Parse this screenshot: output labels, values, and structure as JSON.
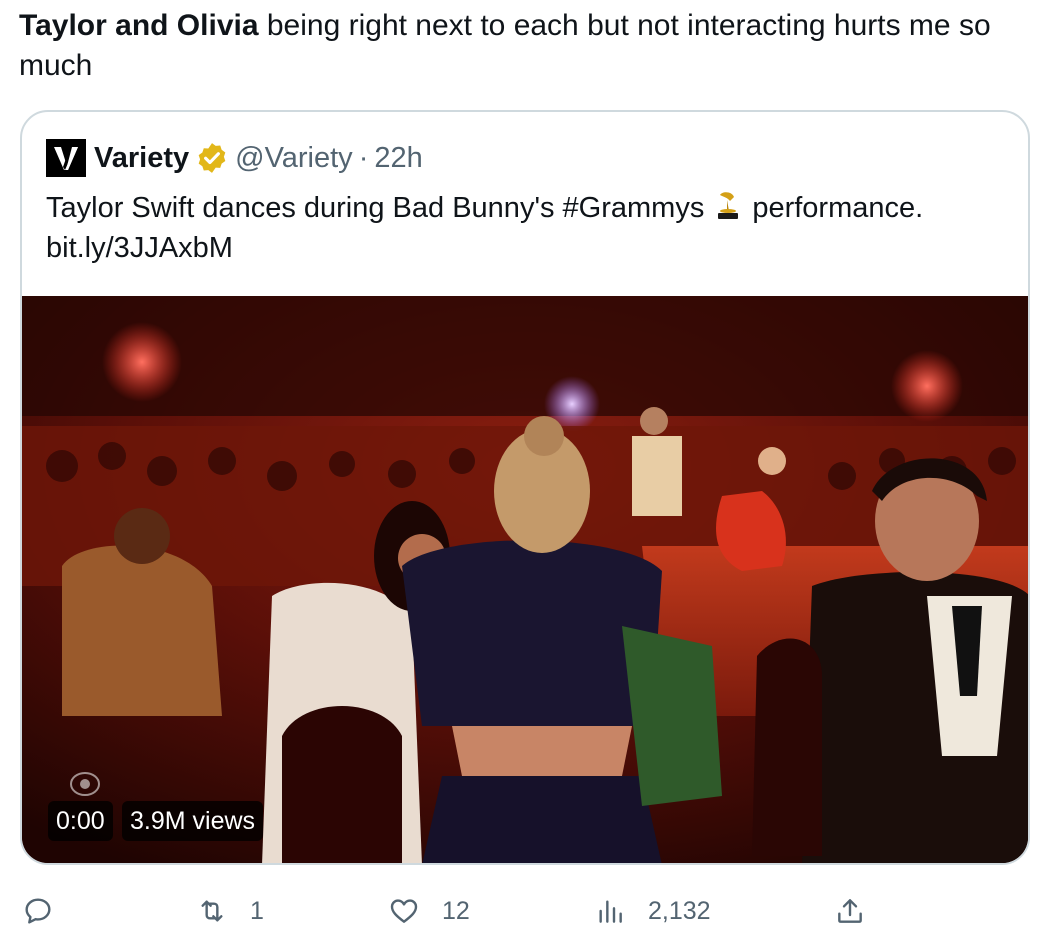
{
  "tweet": {
    "text_bold": "Taylor and Olivia",
    "text_rest": " being right next to each but not interacting hurts me so much"
  },
  "quote": {
    "display_name": "Variety",
    "handle": "@Variety",
    "separator": "·",
    "time": "22h",
    "text_before": "Taylor Swift dances during Bad Bunny's #Grammys",
    "text_after": "performance.",
    "link": "bit.ly/3JJAxbM",
    "logo_letter": "V",
    "emoji_icon": "trophy-gramophone-icon",
    "verified_color": "#e2b719"
  },
  "video": {
    "time": "0:00",
    "views": "3.9M views"
  },
  "actions": {
    "reply": {
      "icon": "reply-icon",
      "count": ""
    },
    "retweet": {
      "icon": "retweet-icon",
      "count": "1"
    },
    "like": {
      "icon": "heart-icon",
      "count": "12"
    },
    "views": {
      "icon": "analytics-icon",
      "count": "2,132"
    },
    "share": {
      "icon": "share-icon",
      "count": ""
    }
  },
  "colors": {
    "text": "#0f1419",
    "secondary": "#536471",
    "border": "#cfd9de"
  }
}
